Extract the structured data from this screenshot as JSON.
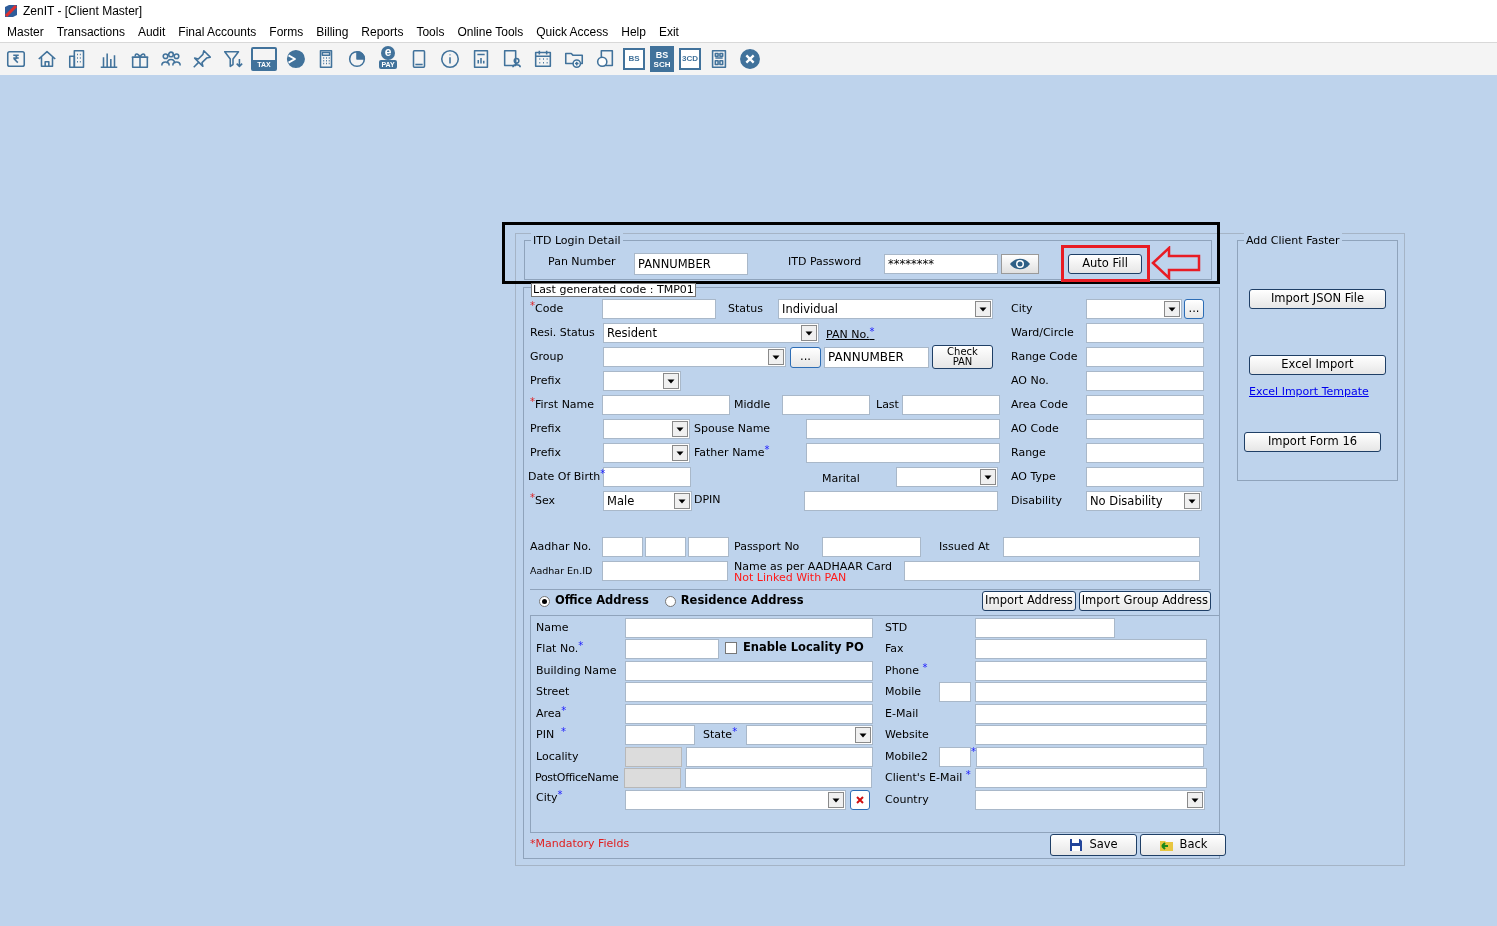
{
  "window": {
    "title": "ZenIT - [Client Master]"
  },
  "menu": [
    "Master",
    "Transactions",
    "Audit",
    "Final Accounts",
    "Forms",
    "Billing",
    "Reports",
    "Tools",
    "Online Tools",
    "Quick Access",
    "Help",
    "Exit"
  ],
  "toolbar": [
    {
      "kind": "receipt"
    },
    {
      "kind": "home"
    },
    {
      "kind": "building"
    },
    {
      "kind": "bars"
    },
    {
      "kind": "gift"
    },
    {
      "kind": "people"
    },
    {
      "kind": "pin"
    },
    {
      "kind": "filter"
    },
    {
      "kind": "tax",
      "text": "TAX"
    },
    {
      "kind": "disc"
    },
    {
      "kind": "calculator"
    },
    {
      "kind": "pie"
    },
    {
      "kind": "epay",
      "text": "e",
      "subtext": "PAY"
    },
    {
      "kind": "book"
    },
    {
      "kind": "info"
    },
    {
      "kind": "report"
    },
    {
      "kind": "userdoc"
    },
    {
      "kind": "calendar"
    },
    {
      "kind": "folderadd"
    },
    {
      "kind": "doccircle"
    },
    {
      "kind": "badge",
      "text": "BS"
    },
    {
      "kind": "badge2",
      "text": "BS",
      "subtext": "SCH"
    },
    {
      "kind": "badge",
      "text": "3CD"
    },
    {
      "kind": "grid"
    },
    {
      "kind": "close"
    }
  ],
  "itd_login": {
    "legend": "ITD Login Detail",
    "pan_label": "Pan Number",
    "pan_value": "PANNUMBER",
    "password_label": "ITD Password",
    "password_value": "********",
    "auto_fill": "Auto Fill"
  },
  "client": {
    "note": "Last generated code : TMP01",
    "code": {
      "label": "Code",
      "mark_before": "*"
    },
    "status": {
      "label": "Status",
      "value": "Individual"
    },
    "city": {
      "label": "City",
      "button": "..."
    },
    "resi_status": {
      "label": "Resi. Status",
      "value": "Resident"
    },
    "pan_no": {
      "label": "PAN No.",
      "mark_after": "*",
      "value": "PANNUMBER",
      "check_button": "Check PAN"
    },
    "ward_circle": {
      "label": "Ward/Circle"
    },
    "group": {
      "label": "Group",
      "button": "..."
    },
    "range_code": {
      "label": "Range Code"
    },
    "prefix_1": {
      "label": "Prefix"
    },
    "ao_no": {
      "label": "AO No."
    },
    "first_name": {
      "label": "First Name",
      "mark_before": "*"
    },
    "middle": {
      "label": "Middle"
    },
    "last": {
      "label": "Last"
    },
    "area_code": {
      "label": "Area Code"
    },
    "prefix_2": {
      "label": "Prefix"
    },
    "spouse_name": {
      "label": "Spouse Name"
    },
    "ao_code": {
      "label": "AO Code"
    },
    "prefix_3": {
      "label": "Prefix"
    },
    "father_name": {
      "label": "Father Name",
      "mark_after": "*"
    },
    "range": {
      "label": "Range"
    },
    "date_of_birth": {
      "label": "Date Of Birth",
      "mark_after": "*"
    },
    "marital": {
      "label": "Marital"
    },
    "ao_type": {
      "label": "AO Type"
    },
    "sex": {
      "label": "Sex",
      "mark_before": "*",
      "value": "Male"
    },
    "dpin": {
      "label": "DPIN"
    },
    "disability": {
      "label": "Disability",
      "value": "No Disability"
    },
    "aadhar_no": {
      "label": "Aadhar No."
    },
    "passport_no": {
      "label": "Passport No"
    },
    "issued_at": {
      "label": "Issued At"
    },
    "aadhar_en_id": {
      "label": "Aadhar En.ID"
    },
    "name_as_per_aadhaar": {
      "label": "Name as per AADHAAR Card",
      "note": "Not Linked With PAN"
    }
  },
  "address": {
    "options": [
      {
        "label": "Office Address",
        "selected": true
      },
      {
        "label": "Residence Address",
        "selected": false
      }
    ],
    "import_buttons": [
      "Import Address",
      "Import Group Address"
    ],
    "name": {
      "label": "Name"
    },
    "std": {
      "label": "STD"
    },
    "flat_no": {
      "label": "Flat No.",
      "mark_after": "*"
    },
    "enable_locality_po": {
      "label": "Enable Locality PO",
      "checked": false
    },
    "fax": {
      "label": "Fax"
    },
    "building_name": {
      "label": "Building Name"
    },
    "phone": {
      "label": "Phone ",
      "mark_after": "*"
    },
    "street": {
      "label": "Street"
    },
    "mobile": {
      "label": "Mobile"
    },
    "area": {
      "label": "Area",
      "mark_after": "*"
    },
    "email": {
      "label": "E-Mail"
    },
    "pin": {
      "label": "PIN  ",
      "mark_after": "*"
    },
    "state": {
      "label": "State",
      "mark_after": "*"
    },
    "website": {
      "label": "Website"
    },
    "locality": {
      "label": "Locality"
    },
    "mobile2": {
      "label": "Mobile2",
      "mark": "*"
    },
    "post_office_name": {
      "label": "PostOfficeName"
    },
    "clients_email": {
      "label": "Client's E-Mail ",
      "mark_after": "*"
    },
    "city": {
      "label": "City",
      "mark_after": "*"
    },
    "country": {
      "label": "Country"
    }
  },
  "footer": {
    "note": "*Mandatory Fields",
    "save": "Save",
    "back": "Back"
  },
  "add_client_faster": {
    "legend": "Add Client Faster",
    "import_json": "Import JSON File",
    "excel_import": "Excel Import",
    "template_link": "Excel Import Tempate",
    "import_form16": "Import Form 16"
  }
}
